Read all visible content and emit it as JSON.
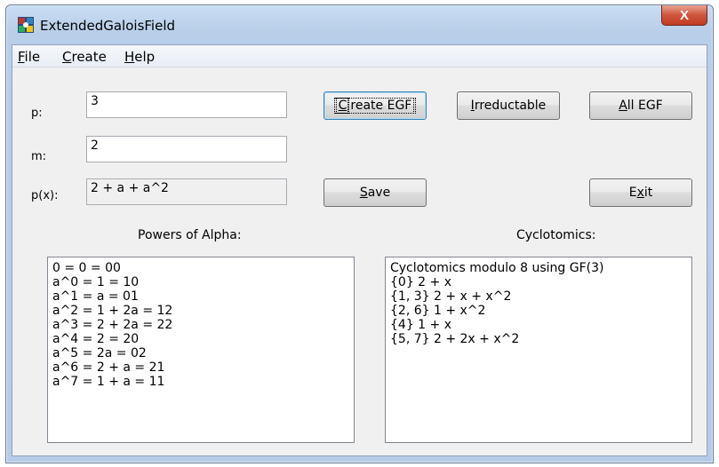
{
  "window": {
    "title": "ExtendedGaloisField",
    "close_label": "X"
  },
  "menu": [
    {
      "accel": "F",
      "rest": "ile"
    },
    {
      "accel": "C",
      "rest": "reate"
    },
    {
      "accel": "H",
      "rest": "elp"
    }
  ],
  "fields": {
    "p": {
      "label": "p:",
      "value": "3"
    },
    "m": {
      "label": "m:",
      "value": "2"
    },
    "px": {
      "label": "p(x):",
      "value": "2 + a + a^2"
    }
  },
  "buttons": {
    "create_egf": {
      "accel": "C",
      "rest": "reate EGF"
    },
    "irreductable": {
      "accel": "I",
      "rest": "rreductable"
    },
    "all_egf": {
      "accel": "A",
      "rest": "ll EGF"
    },
    "save": {
      "accel": "S",
      "rest": "ave"
    },
    "exit": {
      "pre": "E",
      "accel": "x",
      "rest": "it"
    }
  },
  "powers": {
    "header": "Powers of Alpha:",
    "lines": [
      "0 = 0 = 00",
      "a^0 = 1 = 10",
      "a^1 = a = 01",
      "a^2 = 1 + 2a = 12",
      "a^3 = 2 + 2a = 22",
      "a^4 = 2 = 20",
      "a^5 = 2a = 02",
      "a^6 = 2 + a = 21",
      "a^7 = 1 + a = 11"
    ]
  },
  "cyclotomics": {
    "header": "Cyclotomics:",
    "lines": [
      "Cyclotomics modulo 8 using GF(3)",
      "{0}  2 + x",
      "{1, 3}  2 + x + x^2",
      "{2, 6}  1 + x^2",
      "{4}  1 + x",
      "{5, 7}  2 + 2x + x^2"
    ]
  },
  "colors": {
    "titlebar": "#b9cfe9",
    "client": "#f0f0f0",
    "close": "#c23c22"
  },
  "icons": [
    "app-icon",
    "close-icon"
  ]
}
